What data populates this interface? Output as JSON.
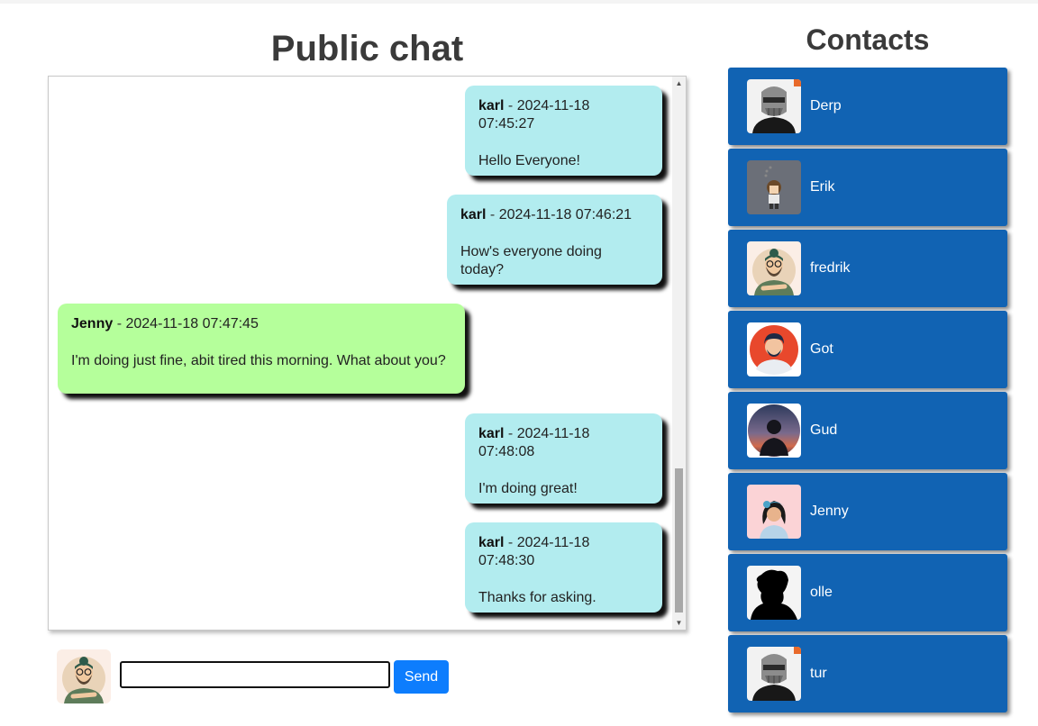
{
  "chat": {
    "title": "Public chat",
    "messages": [
      {
        "author": "karl",
        "time": "2024-11-18 07:45:27",
        "text": "Hello Everyone!",
        "mine": true
      },
      {
        "author": "karl",
        "time": "2024-11-18 07:46:21",
        "text": "How's everyone doing today?",
        "mine": true
      },
      {
        "author": "Jenny",
        "time": "2024-11-18 07:47:45",
        "text": "I'm doing just fine, abit tired this morning. What about you?",
        "mine": false
      },
      {
        "author": "karl",
        "time": "2024-11-18 07:48:08",
        "text": "I'm doing great!",
        "mine": true
      },
      {
        "author": "karl",
        "time": "2024-11-18 07:48:30",
        "text": "Thanks for asking.",
        "mine": true
      }
    ],
    "separator": " - ",
    "bubble_colors": {
      "mine": "#b2ecef",
      "theirs": "#b5ff9b"
    }
  },
  "composer": {
    "input_value": "",
    "send_label": "Send",
    "avatar_icon": "bearded-man-avatar-icon"
  },
  "contacts": {
    "title": "Contacts",
    "items": [
      {
        "name": "Derp",
        "avatar": "masked-villain-avatar-icon"
      },
      {
        "name": "Erik",
        "avatar": "pixel-character-avatar-icon"
      },
      {
        "name": "fredrik",
        "avatar": "bearded-man-avatar-icon"
      },
      {
        "name": "Got",
        "avatar": "man-red-background-avatar-icon"
      },
      {
        "name": "Gud",
        "avatar": "silhouette-sunset-avatar-icon"
      },
      {
        "name": "Jenny",
        "avatar": "woman-blue-hair-avatar-icon"
      },
      {
        "name": "olle",
        "avatar": "black-silhouette-avatar-icon"
      },
      {
        "name": "tur",
        "avatar": "masked-villain-avatar-icon"
      }
    ],
    "card_color": "#1163b3"
  }
}
